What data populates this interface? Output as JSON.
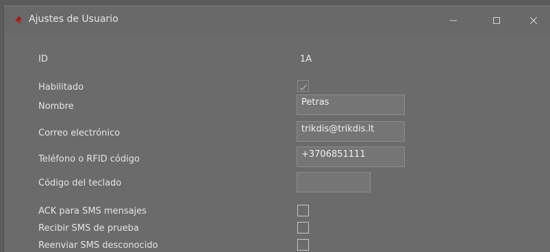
{
  "window": {
    "title": "Ajustes de Usuario",
    "icons": [
      "app-icon",
      "minimize-icon",
      "maximize-icon",
      "close-icon"
    ]
  },
  "form": {
    "id_label": "ID",
    "id_value": "1A",
    "enabled_label": "Habilitado",
    "enabled_checked": true,
    "name_label": "Nombre",
    "name_value": "Petras",
    "email_label": "Correo electrónico",
    "email_value": "trikdis@trikdis.lt",
    "phone_label": "Teléfono o RFID código",
    "phone_value": "+3706851111",
    "keypad_label": "Código del teclado",
    "keypad_value": "",
    "ack_label": "ACK para SMS mensajes",
    "ack_checked": false,
    "test_sms_label": "Recibir SMS de prueba",
    "test_sms_checked": false,
    "forward_label": "Reenviar SMS desconocido",
    "forward_checked": false
  },
  "colors": {
    "overlay_background": "#6b6b6b",
    "text": "#e4e4e4",
    "field_background": "#757575"
  }
}
